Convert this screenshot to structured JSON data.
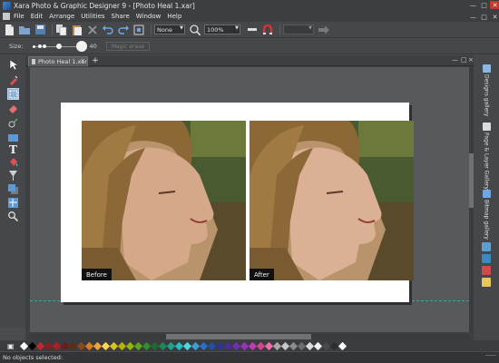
{
  "window": {
    "title": "Xara Photo & Graphic Designer 9 - [Photo Heal 1.xar]"
  },
  "menubar": {
    "items": [
      "File",
      "Edit",
      "Arrange",
      "Utilities",
      "Share",
      "Window",
      "Help"
    ]
  },
  "toolbar": {
    "feather_value": "None",
    "zoom_value": "100%"
  },
  "infobar": {
    "size_label": "Size:",
    "size_value": "40",
    "magic_erase_label": "Magic erase"
  },
  "document": {
    "tab_label": "Photo Heal 1.xar",
    "before_label": "Before",
    "after_label": "After"
  },
  "right_gallery": {
    "tabs": [
      "Designs gallery",
      "Page & Layer Gallery",
      "Bitmap gallery"
    ]
  },
  "status": {
    "text": "No objects selected:"
  },
  "colors": {
    "accent": "#8fb2d6",
    "guide": "#3aa6a0",
    "palette": [
      "#ffffff",
      "#000000",
      "#c62828",
      "#8e1e1e",
      "#b71c1c",
      "#6d1b1b",
      "#5d2e12",
      "#8d4a1e",
      "#e07b1a",
      "#f2a23a",
      "#ffd54f",
      "#d8c21a",
      "#b5b400",
      "#8fb800",
      "#5aa61c",
      "#2f8f2a",
      "#1e6b2d",
      "#1b8a5a",
      "#17a58c",
      "#23c0c0",
      "#4fd6e0",
      "#3aa0d8",
      "#2a6fc6",
      "#1f4fa8",
      "#2b3590",
      "#4a2c9a",
      "#6e2fb0",
      "#9b30c0",
      "#c23ab8",
      "#d6458f",
      "#ee6fa9",
      "#a7a7a7",
      "#c8c8c8",
      "#8c8c8c",
      "#6e6e6e",
      "#dcdcdc",
      "#f0f0f0",
      "#4b4b4b",
      "#2d2d2d",
      "#ffffff"
    ]
  }
}
